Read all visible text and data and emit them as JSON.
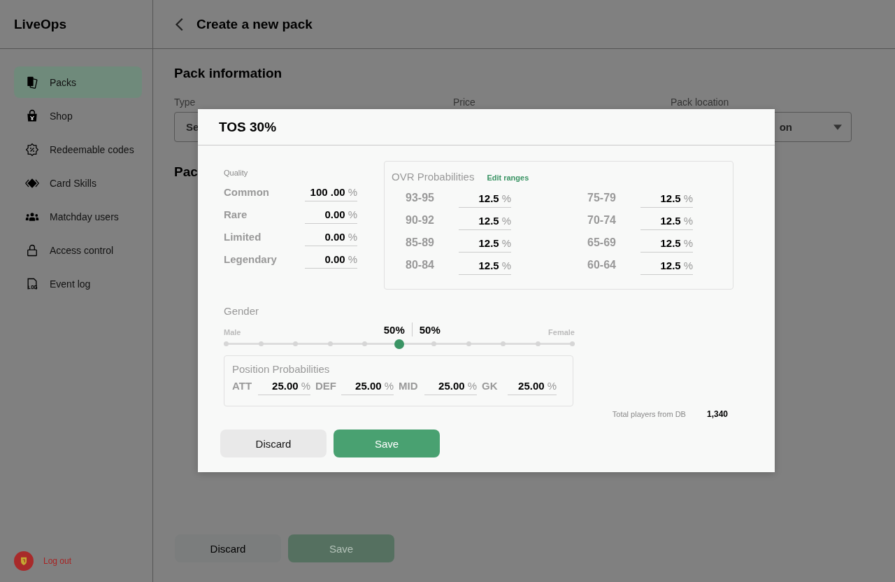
{
  "sidebar": {
    "logo": "LiveOps",
    "items": [
      {
        "label": "Packs",
        "selected": true
      },
      {
        "label": "Shop",
        "selected": false
      },
      {
        "label": "Redeemable codes",
        "selected": false
      },
      {
        "label": "Card Skills",
        "selected": false
      },
      {
        "label": "Matchday users",
        "selected": false
      },
      {
        "label": "Access control",
        "selected": false
      },
      {
        "label": "Event log",
        "selected": false
      }
    ],
    "logout": "Log out"
  },
  "header": {
    "title": "Create a new pack"
  },
  "page": {
    "section_title": "Pack information",
    "fields": [
      {
        "label": "Type",
        "value": "Se"
      },
      {
        "label": "Price"
      },
      {
        "label": "Pack location",
        "value": "on"
      }
    ],
    "section2_title": "Pac",
    "buttons": [
      {
        "label": "Discard",
        "kind": "secondary"
      },
      {
        "label": "Save",
        "kind": "primary"
      }
    ]
  },
  "modal": {
    "title": "TOS 30%",
    "quality": {
      "label": "Quality",
      "rows": [
        {
          "name": "Common",
          "value": "100 .00",
          "unit": "%"
        },
        {
          "name": "Rare",
          "value": "0.00",
          "unit": "%"
        },
        {
          "name": "Limited",
          "value": "0.00",
          "unit": "%"
        },
        {
          "name": "Legendary",
          "value": "0.00",
          "unit": "%"
        }
      ]
    },
    "ovr": {
      "title": "OVR Probabilities",
      "link": "Edit ranges",
      "rows": [
        {
          "range": "93-95",
          "value": "12.5",
          "unit": "%"
        },
        {
          "range": "90-92",
          "value": "12.5",
          "unit": "%"
        },
        {
          "range": "85-89",
          "value": "12.5",
          "unit": "%"
        },
        {
          "range": "80-84",
          "value": "12.5",
          "unit": "%"
        },
        {
          "range": "75-79",
          "value": "12.5",
          "unit": "%"
        },
        {
          "range": "70-74",
          "value": "12.5",
          "unit": "%"
        },
        {
          "range": "65-69",
          "value": "12.5",
          "unit": "%"
        },
        {
          "range": "60-64",
          "value": "12.5",
          "unit": "%"
        }
      ]
    },
    "gender": {
      "label": "Gender",
      "left": "Male",
      "right": "Female",
      "left_value": "50%",
      "right_value": "50%",
      "level": 0.5
    },
    "positions": {
      "title": "Position Probabilities",
      "items": [
        {
          "name": "ATT",
          "value": "25.00",
          "unit": "%"
        },
        {
          "name": "DEF",
          "value": "25.00",
          "unit": "%"
        },
        {
          "name": "MID",
          "value": "25.00",
          "unit": "%"
        },
        {
          "name": "GK",
          "value": "25.00",
          "unit": "%"
        }
      ]
    },
    "total": {
      "label": "Total players from DB",
      "value": "1,340"
    },
    "buttons": [
      {
        "label": "Discard",
        "kind": "secondary"
      },
      {
        "label": "Save",
        "kind": "primary"
      }
    ]
  }
}
